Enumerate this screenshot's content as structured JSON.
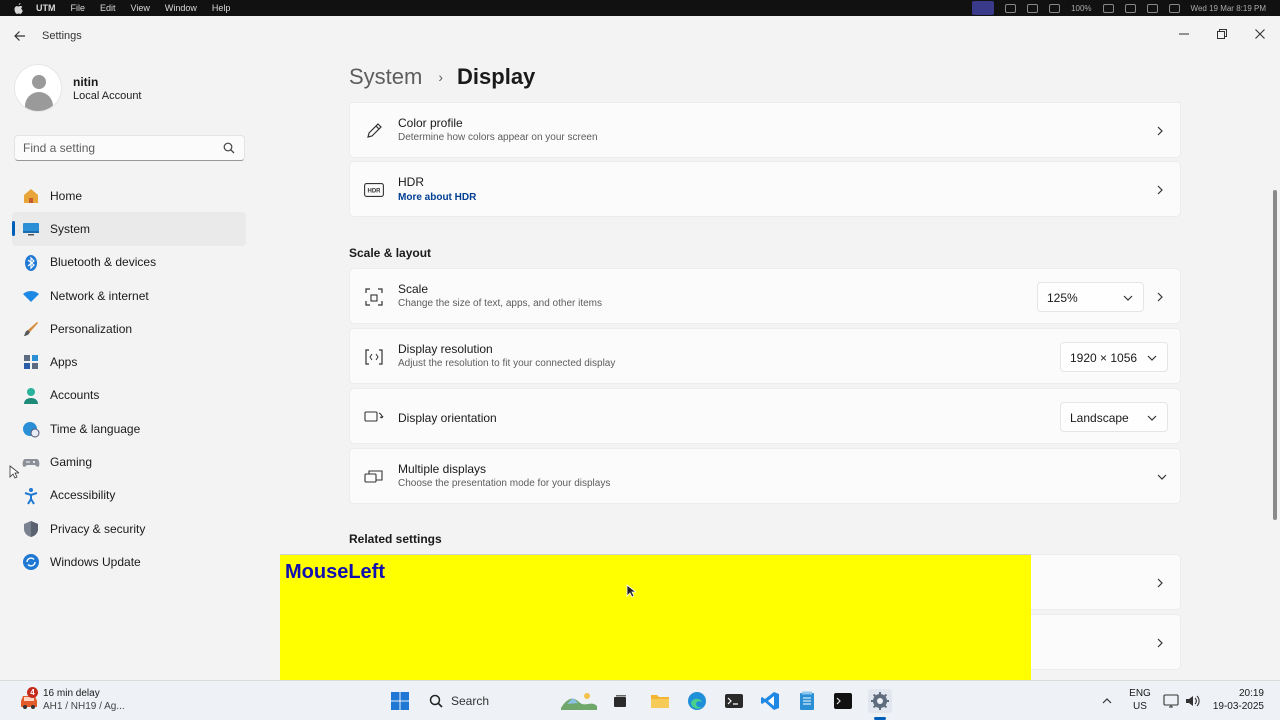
{
  "macbar": {
    "app": "UTM",
    "menus": [
      "File",
      "Edit",
      "View",
      "Window",
      "Help"
    ],
    "battery": "100%",
    "datetime": "Wed 19 Mar 8:19 PM"
  },
  "window": {
    "title": "Settings"
  },
  "profile": {
    "name": "nitin",
    "account_type": "Local Account"
  },
  "search": {
    "placeholder": "Find a setting"
  },
  "nav": {
    "items": [
      {
        "label": "Home",
        "icon": "home-icon"
      },
      {
        "label": "System",
        "icon": "system-icon",
        "active": true
      },
      {
        "label": "Bluetooth & devices",
        "icon": "bluetooth-icon"
      },
      {
        "label": "Network & internet",
        "icon": "wifi-icon"
      },
      {
        "label": "Personalization",
        "icon": "brush-icon"
      },
      {
        "label": "Apps",
        "icon": "apps-icon"
      },
      {
        "label": "Accounts",
        "icon": "accounts-icon"
      },
      {
        "label": "Time & language",
        "icon": "globe-clock-icon"
      },
      {
        "label": "Gaming",
        "icon": "gamepad-icon"
      },
      {
        "label": "Accessibility",
        "icon": "accessibility-icon"
      },
      {
        "label": "Privacy & security",
        "icon": "shield-icon"
      },
      {
        "label": "Windows Update",
        "icon": "update-icon"
      }
    ]
  },
  "breadcrumb": {
    "parent": "System",
    "separator": "›",
    "current": "Display"
  },
  "cards": {
    "color_profile": {
      "title": "Color profile",
      "subtitle": "Determine how colors appear on your screen"
    },
    "hdr": {
      "title": "HDR",
      "link": "More about HDR"
    },
    "scale": {
      "title": "Scale",
      "subtitle": "Change the size of text, apps, and other items",
      "value": "125%"
    },
    "resolution": {
      "title": "Display resolution",
      "subtitle": "Adjust the resolution to fit your connected display",
      "value": "1920 × 1056"
    },
    "orientation": {
      "title": "Display orientation",
      "value": "Landscape"
    },
    "multiple": {
      "title": "Multiple displays",
      "subtitle": "Choose the presentation mode for your displays"
    }
  },
  "sections": {
    "scale_layout": "Scale & layout",
    "related": "Related settings"
  },
  "overlay": {
    "text": "MouseLeft",
    "color": "#ffff00"
  },
  "taskbar": {
    "weather_badge": "4",
    "weather_line1": "16 min delay",
    "weather_line2": "AH1 / NH19 / Ag...",
    "search_label": "Search",
    "lang_line1": "ENG",
    "lang_line2": "US",
    "time": "20:19",
    "date": "19-03-2025"
  },
  "colors": {
    "accent": "#005fb8",
    "link": "#003e92"
  }
}
